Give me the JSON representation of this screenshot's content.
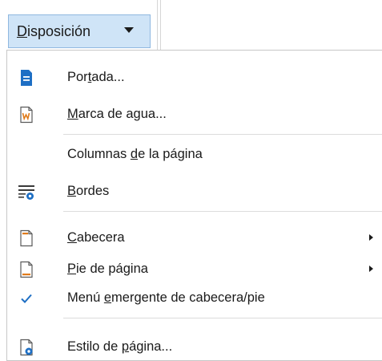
{
  "toolbar": {
    "button_label_u": "D",
    "button_label_rest": "isposición"
  },
  "menu": {
    "items": [
      {
        "pre": "Por",
        "u": "t",
        "post": "ada...",
        "icon": "title-page-icon"
      },
      {
        "pre": "",
        "u": "M",
        "post": "arca de agua...",
        "icon": "watermark-icon"
      },
      {
        "pre": "Columnas ",
        "u": "d",
        "post": "e la página",
        "icon": ""
      },
      {
        "pre": "",
        "u": "B",
        "post": "ordes",
        "icon": "borders-icon"
      },
      {
        "pre": "",
        "u": "C",
        "post": "abecera",
        "icon": "header-icon",
        "submenu": true
      },
      {
        "pre": "",
        "u": "P",
        "post": "ie de página",
        "icon": "footer-icon",
        "submenu": true
      },
      {
        "pre": "Menú ",
        "u": "e",
        "post": "mergente de cabecera/pie",
        "icon": "checkmark-icon",
        "checked": true
      },
      {
        "pre": "Estilo de ",
        "u": "p",
        "post": "ágina...",
        "icon": "page-style-icon"
      }
    ]
  },
  "colors": {
    "button_bg": "#cfe4f7",
    "icon_blue": "#1e6fc4",
    "icon_orange": "#e07b1a"
  }
}
